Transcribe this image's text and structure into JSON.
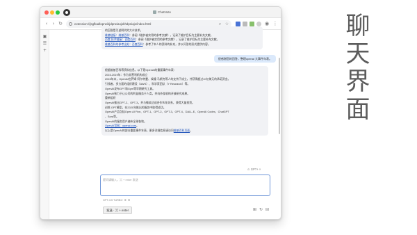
{
  "browser": {
    "window_title": "ChatNote",
    "url": "extension://jsgfkadlopneikjdpneiaojokhdpniaje/index.html"
  },
  "chat": {
    "ai_message_1": [
      "的回答是引述明代的大众技术。",
      {
        "text": "维基链接：维基百科",
        "suffix": "：参阅《维护者实用的参考文献》，记录了维护目标为主要补充文献。"
      },
      {
        "text": "百度 技术链接：百度百科",
        "suffix": "：参阅《维护者实用的参考文献》，记录了维护目标为主要补充文献。"
      },
      {
        "text": "维基百科的参考出处：百度百科",
        "suffix": "：参考了本人的资料的补充，并以问答的形式提供内容。"
      }
    ],
    "user_message": "很感谢您的回答，整理openai 大事件年表。",
    "ai_message_2": [
      "根据维基百科等资料信息，以下是OpenAI的重要事件年表：",
      "2015-2019年：作为非营利机构成立",
      "2015年末，OpenAI在萨姆·阿尔特曼、埃隆·马斯克等人的支持下成立，并获得超过10亿美元的承诺资金。",
      "引领者、多方面的组织建设（AWS）、科学家团队（Y Research）等。",
      "OpenAI发布GPT和Gym等早期研究工具。",
      "OpenAI致力于让公司的利益服务于人类，并向外部机构开放研究成果。",
      "重新组织",
      "OpenAI推出GPT-2、GPT-3，并与微软达成合作伙伴关系，获得大量投资。",
      "训练 GPT模型，在2020年推出的服务中取得成功。",
      "OpenAI产品包括Open AI Five、GPT-1、GPT-2、GPT-3、GPT-4、DALL-E、OpenAI Codex、ChatGPT",
      "、Sora等。",
      "OpenAI的服务用户遍布全球各地。",
      {
        "text": "OpenAI官网：openai.com",
        "suffix": "。"
      },
      {
        "text": "以上是OpenAI的部分重要事件年表，更多详细信息请访问",
        "link": "维基百科页面",
        "suffix": "。"
      }
    ]
  },
  "composer": {
    "model_tag": "GPT+",
    "placeholder": "提问请输入，⌘ + enter 发送",
    "token_info": "GPT-3.5 TURBO",
    "send_label": "发送 · ⌘ + enter"
  },
  "side_title": [
    "聊",
    "天",
    "界",
    "面"
  ],
  "colors": {
    "accent": "#6f96d8",
    "user_bubble": "#dbe9fb",
    "ai_bubble": "#f1f2f5"
  }
}
